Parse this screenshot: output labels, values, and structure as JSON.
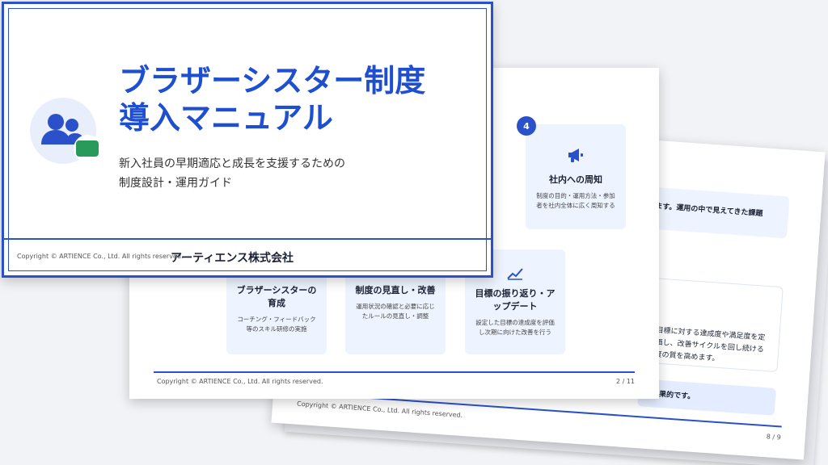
{
  "cover": {
    "title_line1": "ブラザーシスター制度",
    "title_line2": "導入マニュアル",
    "subtitle_line1": "新入社員の早期適応と成長を支援するための",
    "subtitle_line2": "制度設計・運用ガイド",
    "copyright": "Copyright © ARTIENCE Co., Ltd. All rights reserved.",
    "company": "アーティエンス株式会社",
    "icons": [
      "users-icon",
      "handshake-icon"
    ]
  },
  "slide_mid": {
    "step4_number": "4",
    "step4_title": "社内への周知",
    "step4_desc": "制度の目的・運用方法・参加者を社内全体に広く周知する",
    "steps": [
      {
        "title": "ブラザーシスターの育成",
        "desc": "コーチング・フィードバック等のスキル研修の実施",
        "icon": "users-icon"
      },
      {
        "title": "制度の見直し・改善",
        "desc": "運用状況の確認と必要に応じたルールの見直し・調整",
        "icon": "refresh-icon"
      },
      {
        "title": "目標の振り返り・アップデート",
        "desc": "設定した目標の達成度を評価し次期に向けた改善を行う",
        "icon": "chart-line-icon"
      }
    ],
    "copyright": "Copyright © ARTIENCE Co., Ltd. All rights reserved.",
    "page": "2 / 11",
    "icons": [
      "megaphone-icon"
    ]
  },
  "slide_back": {
    "text1": "ます。運用の中で見えてきた課題",
    "label": "定",
    "note_line1": "た目標に対する達成度や満足度を定",
    "note_line2": "評価し、改善サイクルを回し続ける",
    "note_line3": "制度の質を高めます。",
    "text2": "も効果的です。",
    "copyright": "Copyright © ARTIENCE Co., Ltd. All rights reserved.",
    "page": "8 / 9"
  }
}
